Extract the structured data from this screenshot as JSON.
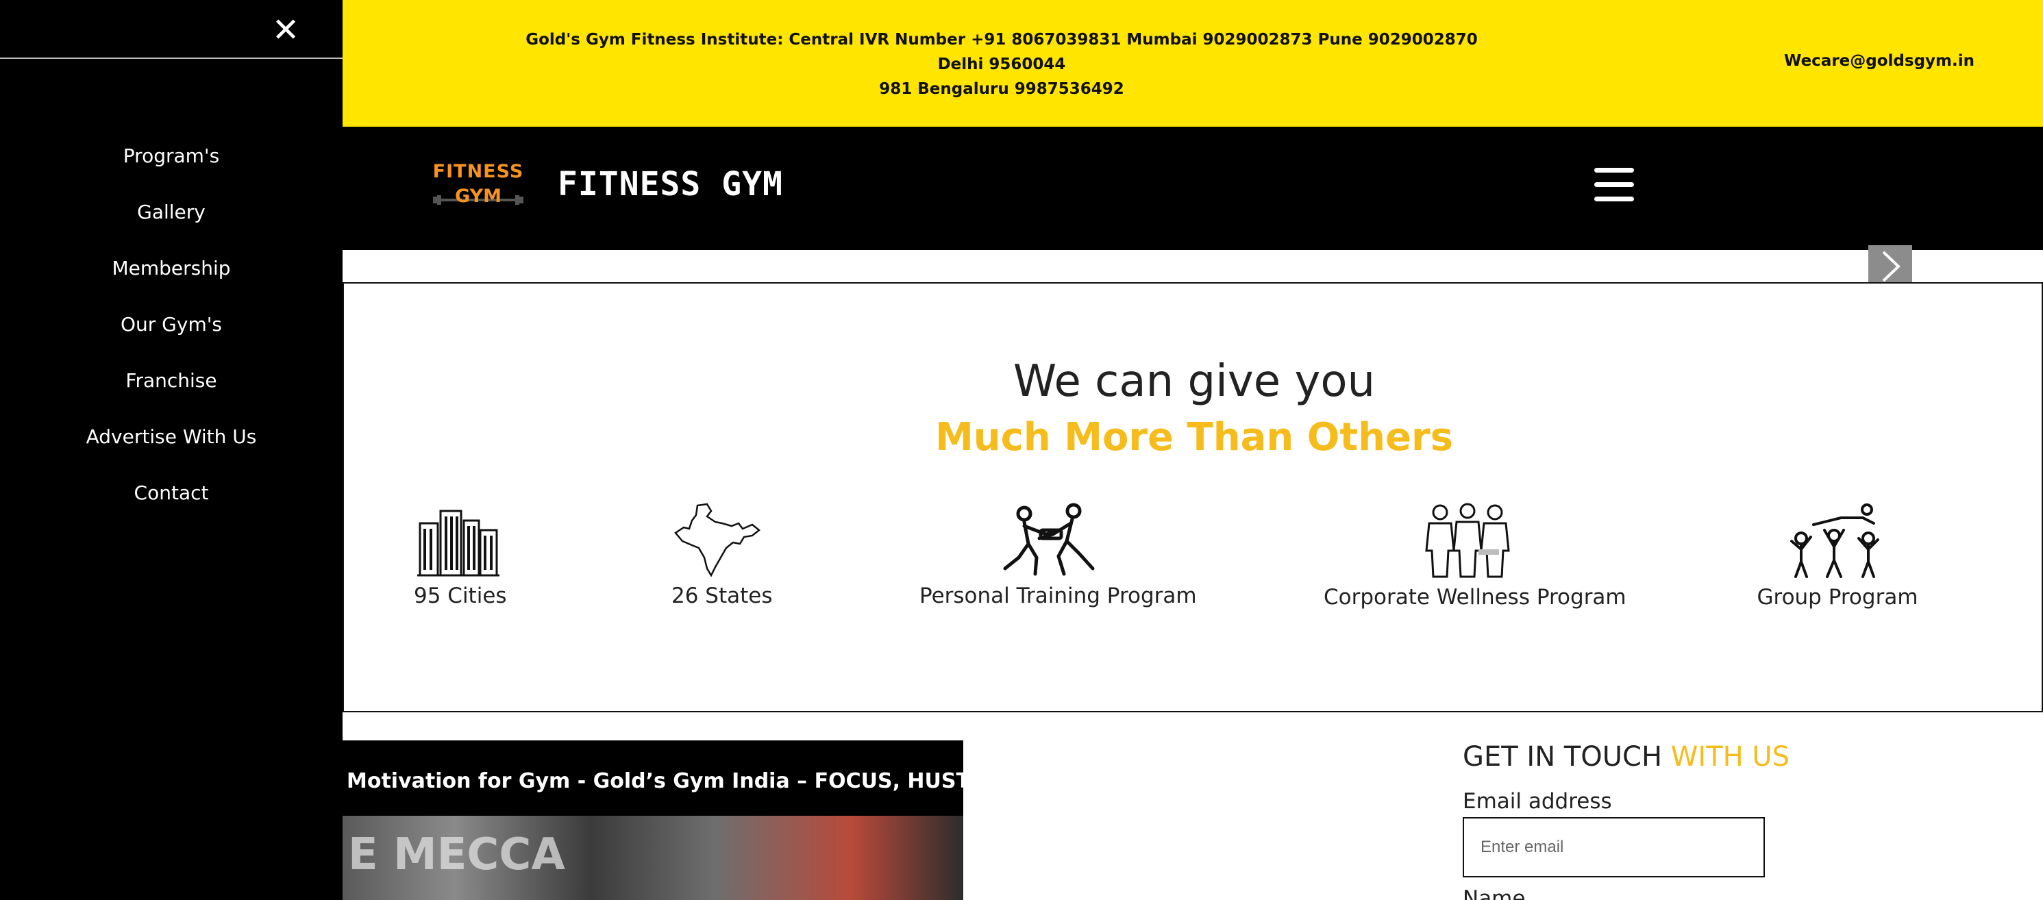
{
  "sidebar": {
    "close_icon": "close-icon",
    "items": [
      {
        "label": "Program's"
      },
      {
        "label": "Gallery"
      },
      {
        "label": "Membership"
      },
      {
        "label": "Our Gym's"
      },
      {
        "label": "Franchise"
      },
      {
        "label": "Advertise With Us"
      },
      {
        "label": "Contact"
      }
    ]
  },
  "topbar": {
    "contact_line1": "Gold's Gym Fitness Institute: Central IVR Number +91 8067039831 Mumbai 9029002873 Pune 9029002870 Delhi 9560044",
    "contact_line2": "981 Bengaluru 9987536492",
    "email": "Wecare@goldsgym.in",
    "background": "#ffe500"
  },
  "header": {
    "logo_line1": "FITNESS",
    "logo_line2": "GYM",
    "brand": "FITNESS GYM",
    "menu_icon": "hamburger-icon"
  },
  "slider": {
    "next_icon": "chevron-right-icon"
  },
  "features": {
    "heading": "We can give you",
    "subheading": "Much More Than Others",
    "accent_color": "#f5bc1b",
    "items": [
      {
        "label": "95 Cities",
        "icon": "city-buildings-icon"
      },
      {
        "label": "26 States",
        "icon": "india-map-icon"
      },
      {
        "label": "Personal Training Program",
        "icon": "personal-training-icon"
      },
      {
        "label": "Corporate Wellness Program",
        "icon": "corporate-team-icon"
      },
      {
        "label": "Group Program",
        "icon": "group-program-icon"
      }
    ]
  },
  "video": {
    "title": "Motivation for Gym - Gold’s Gym India – FOCUS, HUSTLE a...",
    "thumb_text": "E MECCA",
    "play_icon": "youtube-play-icon"
  },
  "contact": {
    "title": "GET IN TOUCH",
    "title_accent": "WITH US",
    "email_label": "Email address",
    "email_placeholder": "Enter email",
    "name_label": "Name"
  }
}
